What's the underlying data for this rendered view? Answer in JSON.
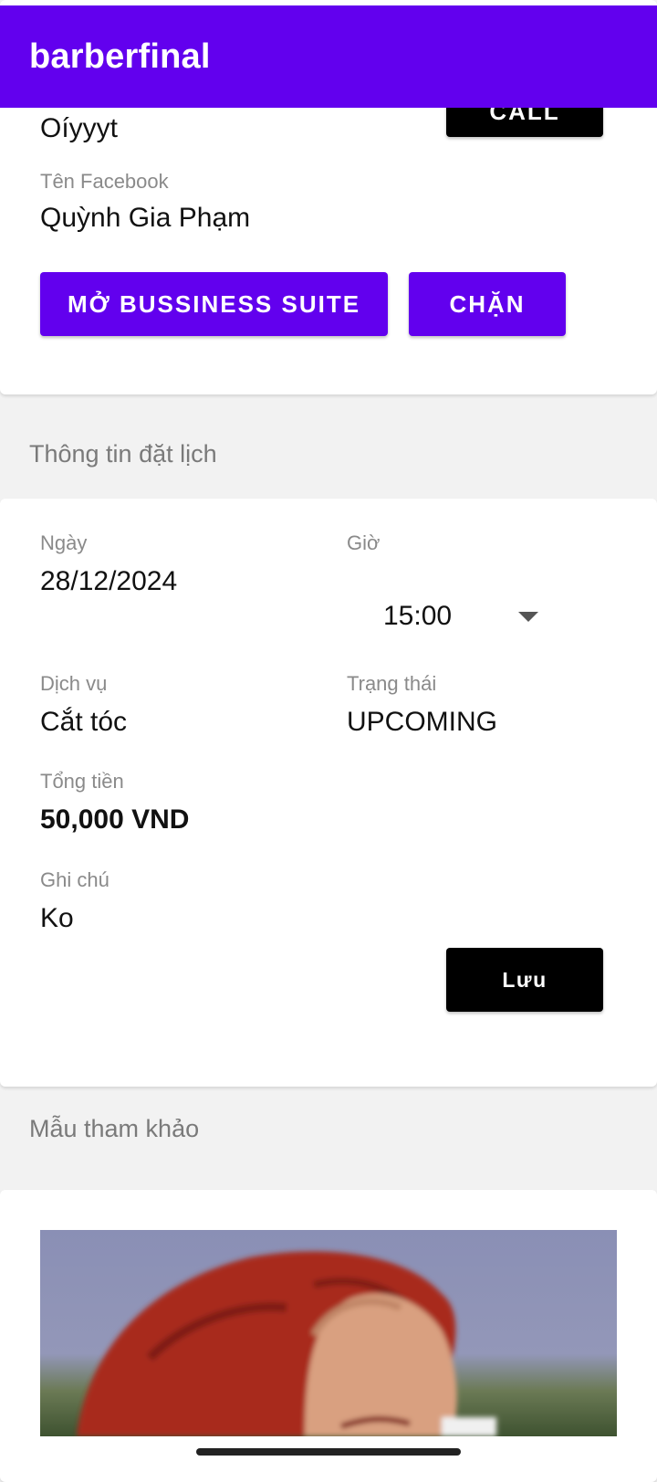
{
  "app": {
    "title": "barberfinal"
  },
  "customer": {
    "name_value": "Oíyyyt",
    "call_label": "CALL",
    "facebook_label": "Tên Facebook",
    "facebook_value": "Quỳnh Gia Phạm",
    "open_suite_label": "MỞ BUSSINESS SUITE",
    "block_label": "CHẶN"
  },
  "booking": {
    "section_title": "Thông tin đặt lịch",
    "date_label": "Ngày",
    "date_value": "28/12/2024",
    "time_label": "Giờ",
    "time_value": "15:00",
    "service_label": "Dịch vụ",
    "service_value": "Cắt tóc",
    "status_label": "Trạng thái",
    "status_value": "UPCOMING",
    "total_label": "Tổng tiền",
    "total_value": "50,000 VND",
    "note_label": "Ghi chú",
    "note_value": "Ko",
    "save_label": "Lưu"
  },
  "reference": {
    "section_title": "Mẫu tham khảo"
  },
  "colors": {
    "primary": "#6200ee",
    "button_dark": "#000000",
    "label_gray": "#8a8a8a"
  }
}
